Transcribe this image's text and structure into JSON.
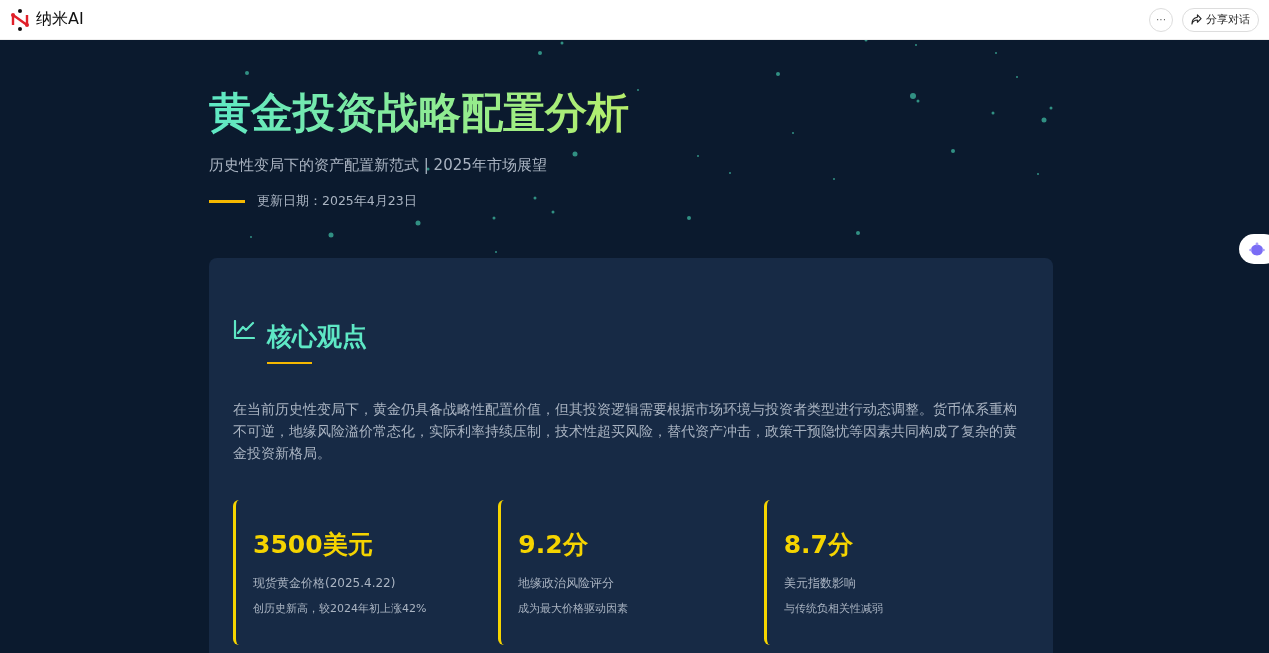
{
  "header": {
    "brand": "纳米AI",
    "more_button": "···",
    "share_button": "分享对话"
  },
  "hero": {
    "title": "黄金投资战略配置分析",
    "subtitle": "历史性变局下的资产配置新范式 | 2025年市场展望",
    "updated": "更新日期：2025年4月23日"
  },
  "section": {
    "heading": "核心观点",
    "paragraph": "在当前历史性变局下，黄金仍具备战略性配置价值，但其投资逻辑需要根据市场环境与投资者类型进行动态调整。货币体系重构不可逆，地缘风险溢价常态化，实际利率持续压制，技术性超买风险，替代资产冲击，政策干预隐忧等因素共同构成了复杂的黄金投资新格局。",
    "stats": [
      {
        "value": "3500美元",
        "label": "现货黄金价格(2025.4.22)",
        "note": "创历史新高，较2024年初上涨42%"
      },
      {
        "value": "9.2分",
        "label": "地缘政治风险评分",
        "note": "成为最大价格驱动因素"
      },
      {
        "value": "8.7分",
        "label": "美元指数影响",
        "note": "与传统负相关性减弱"
      }
    ]
  }
}
